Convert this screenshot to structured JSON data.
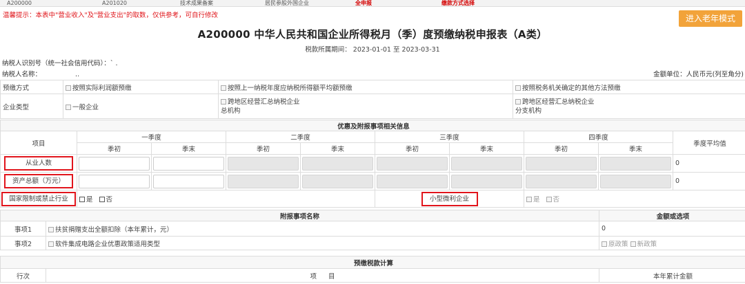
{
  "tabs": [
    {
      "label": "A200000",
      "active": false
    },
    {
      "label": "A201020",
      "active": false
    },
    {
      "label": "技术成果备案",
      "active": false
    },
    {
      "label": "居民参股外国企业",
      "active": false
    },
    {
      "label": "全申报",
      "active": true
    },
    {
      "label": "缴款方式选择",
      "active": true
    }
  ],
  "notice": "温馨提示：本表中\"营业收入\"及\"营业支出\"的取数，仅供参考，可自行修改",
  "old_mode_button": "进入老年模式",
  "form_title": "A200000 中华人民共和国企业所得税月（季）度预缴纳税申报表（A类）",
  "period": "税款所属期间：  2023-01-01 至 2023-03-31",
  "taxpayer_id_label": "纳税人识别号（统一社会信用代码）：` .",
  "taxpayer_name_label": "纳税人名称：",
  "taxpayer_name_value": "..",
  "amount_unit": "金额单位：人民币元(列至角分)",
  "prepay": {
    "label": "预缴方式",
    "options": [
      "按照实际利润额预缴",
      "按照上一纳税年度应纳税所得额平均额预缴",
      "按照税务机关确定的其他方法预缴"
    ]
  },
  "enterprise_type": {
    "label": "企业类型",
    "options": [
      "一般企业",
      "跨地区经营汇总纳税企业",
      "总机构",
      "跨地区经营汇总纳税企业",
      "分支机构"
    ]
  },
  "benefits": {
    "section_title": "优惠及附报事项相关信息",
    "item_header": "项目",
    "quarters": [
      "一季度",
      "二季度",
      "三季度",
      "四季度"
    ],
    "start": "季初",
    "end": "季末",
    "avg_header": "季度平均值",
    "employees_label": "从业人数",
    "employees_avg": "0",
    "assets_label": "资产总额（万元）",
    "assets_avg": "0",
    "restricted_label": "国家限制或禁止行业",
    "yes": "是",
    "no": "否",
    "small_label": "小型微利企业"
  },
  "attached": {
    "section_title": "附报事项名称",
    "amount_header": "金额或选项",
    "items": [
      {
        "no": "事项1",
        "name": "扶贫捐赠支出全额扣除（本年累计，元）",
        "value": "0"
      },
      {
        "no": "事项2",
        "name": "软件集成电路企业优惠政策适用类型",
        "opt1": "原政策",
        "opt2": "新政策"
      }
    ]
  },
  "calc": {
    "section_title": "预缴税款计算",
    "row_header": "行次",
    "item_header": "项",
    "item_header2": "目",
    "cumulative_header": "本年累计金额"
  },
  "colors": {
    "highlight": "#e1141b",
    "notice": "#e0161b",
    "button": "#f2a33a"
  }
}
